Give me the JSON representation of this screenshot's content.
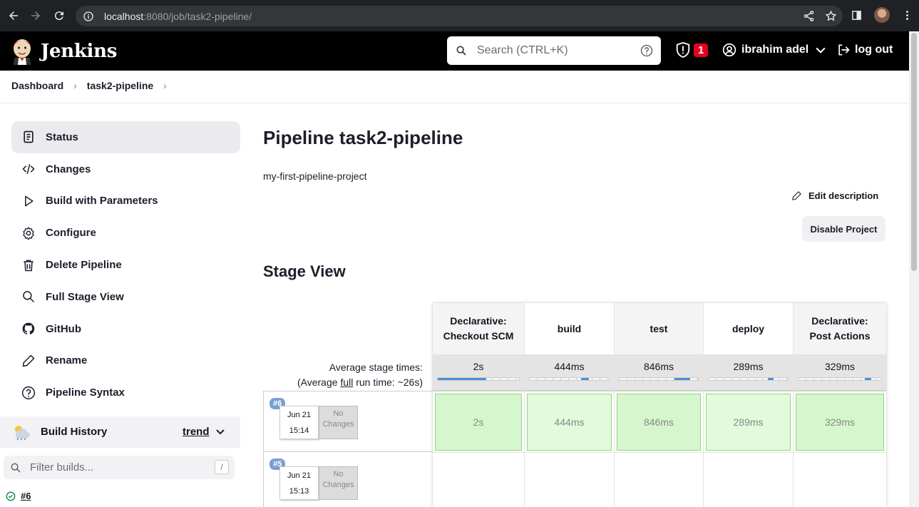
{
  "browser": {
    "url_host": "localhost",
    "url_rest": ":8080/job/task2-pipeline/"
  },
  "header": {
    "brand": "Jenkins",
    "search_placeholder": "Search (CTRL+K)",
    "security_count": "1",
    "user_name": "ibrahim adel",
    "logout_label": "log out"
  },
  "breadcrumb": {
    "items": [
      "Dashboard",
      "task2-pipeline"
    ]
  },
  "sidebar": {
    "items": [
      {
        "label": "Status",
        "icon": "status-icon"
      },
      {
        "label": "Changes",
        "icon": "code-icon"
      },
      {
        "label": "Build with Parameters",
        "icon": "play-icon"
      },
      {
        "label": "Configure",
        "icon": "gear-icon"
      },
      {
        "label": "Delete Pipeline",
        "icon": "trash-icon"
      },
      {
        "label": "Full Stage View",
        "icon": "search-icon"
      },
      {
        "label": "GitHub",
        "icon": "github-icon"
      },
      {
        "label": "Rename",
        "icon": "pencil-icon"
      },
      {
        "label": "Pipeline Syntax",
        "icon": "help-icon"
      }
    ]
  },
  "build_history": {
    "title": "Build History",
    "trend_label": "trend",
    "filter_placeholder": "Filter builds...",
    "filter_shortcut": "/",
    "first_build": "#6"
  },
  "main": {
    "title": "Pipeline task2-pipeline",
    "description": "my-first-pipeline-project",
    "edit_description_label": "Edit description",
    "disable_label": "Disable Project",
    "stage_view_heading": "Stage View"
  },
  "stage_view": {
    "avg_label_1": "Average stage times:",
    "avg_label_2_prefix": "(Average ",
    "avg_label_2_link": "full",
    "avg_label_2_suffix": " run time: ~26s)",
    "stages": [
      {
        "name_line1": "Declarative:",
        "name_line2": "Checkout SCM",
        "avg": "2s",
        "fill": 0.6
      },
      {
        "name_line1": "build",
        "name_line2": "",
        "avg": "444ms",
        "fill": 0.1
      },
      {
        "name_line1": "test",
        "name_line2": "",
        "avg": "846ms",
        "fill": 0.2
      },
      {
        "name_line1": "deploy",
        "name_line2": "",
        "avg": "289ms",
        "fill": 0.07
      },
      {
        "name_line1": "Declarative:",
        "name_line2": "Post Actions",
        "avg": "329ms",
        "fill": 0.08
      }
    ],
    "runs": [
      {
        "id": "#6",
        "date": "Jun 21",
        "time": "15:14",
        "changes": "No Changes",
        "cells": [
          "2s",
          "444ms",
          "846ms",
          "289ms",
          "329ms"
        ]
      },
      {
        "id": "#5",
        "date": "Jun 21",
        "time": "15:13",
        "changes": "No Changes",
        "cells": []
      }
    ]
  }
}
